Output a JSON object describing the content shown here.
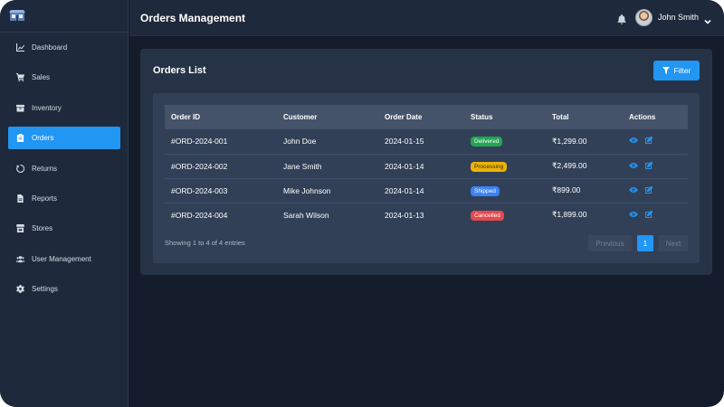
{
  "header": {
    "title": "Orders Management",
    "user_name": "John Smith"
  },
  "sidebar": {
    "items": [
      {
        "label": "Dashboard",
        "icon": "chart-line-icon",
        "active": false
      },
      {
        "label": "Sales",
        "icon": "cart-icon",
        "active": false
      },
      {
        "label": "Inventory",
        "icon": "box-icon",
        "active": false
      },
      {
        "label": "Orders",
        "icon": "clipboard-icon",
        "active": true
      },
      {
        "label": "Returns",
        "icon": "undo-icon",
        "active": false
      },
      {
        "label": "Reports",
        "icon": "file-icon",
        "active": false
      },
      {
        "label": "Stores",
        "icon": "store-icon",
        "active": false
      },
      {
        "label": "User Management",
        "icon": "users-icon",
        "active": false
      },
      {
        "label": "Settings",
        "icon": "gear-icon",
        "active": false
      }
    ]
  },
  "main": {
    "panel_title": "Orders List",
    "filter_label": "Filter",
    "table": {
      "columns": [
        "Order ID",
        "Customer",
        "Order Date",
        "Status",
        "Total",
        "Actions"
      ],
      "rows": [
        {
          "id": "#ORD-2024-001",
          "customer": "John Doe",
          "date": "2024-01-15",
          "status": "Delivered",
          "total": "₹1,299.00"
        },
        {
          "id": "#ORD-2024-002",
          "customer": "Jane Smith",
          "date": "2024-01-14",
          "status": "Processing",
          "total": "₹2,499.00"
        },
        {
          "id": "#ORD-2024-003",
          "customer": "Mike Johnson",
          "date": "2024-01-14",
          "status": "Shipped",
          "total": "₹899.00"
        },
        {
          "id": "#ORD-2024-004",
          "customer": "Sarah Wilson",
          "date": "2024-01-13",
          "status": "Cancelled",
          "total": "₹1,899.00"
        }
      ]
    },
    "footer_info": "Showing 1 to 4 of 4 entries",
    "pagination": {
      "prev": "Previous",
      "current": "1",
      "next": "Next"
    }
  },
  "colors": {
    "accent": "#2196f3",
    "delivered": "#22a553",
    "processing": "#eab308",
    "shipped": "#3b82f6",
    "cancelled": "#e5484d"
  }
}
